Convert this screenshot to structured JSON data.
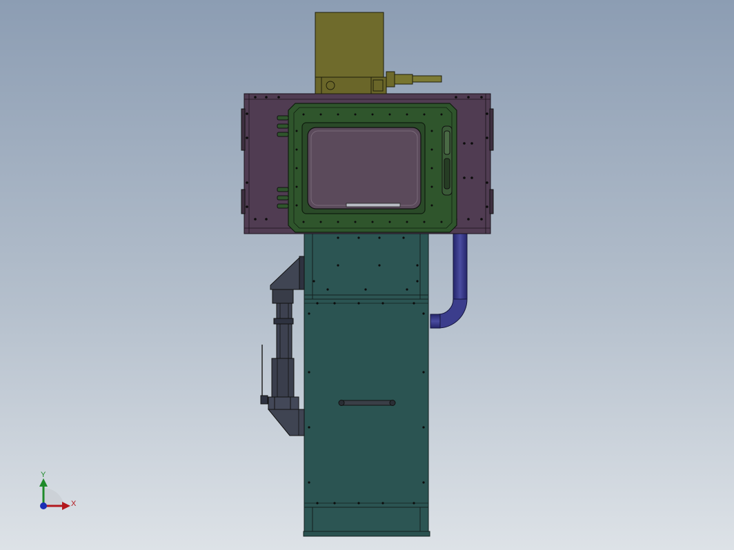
{
  "viewport": {
    "background": "gradient-grey-blue"
  },
  "model": {
    "parts": [
      {
        "name": "gear-motor",
        "color": "#6e6a2b"
      },
      {
        "name": "motor-shaft",
        "color": "#7d7b34"
      },
      {
        "name": "upper-housing",
        "color": "#503c52"
      },
      {
        "name": "door-frame",
        "color": "#2f552c"
      },
      {
        "name": "viewing-window",
        "color": "#5b4a5b"
      },
      {
        "name": "lower-column",
        "color": "#2b5452"
      },
      {
        "name": "side-arm-assembly",
        "color": "#3f4452"
      },
      {
        "name": "coolant-pipe",
        "color": "#34357a"
      },
      {
        "name": "column-handle",
        "color": "#3a3f47"
      }
    ]
  },
  "triad": {
    "x_label": "X",
    "y_label": "Y",
    "x_color": "#b3181d",
    "y_color": "#1f8a2a",
    "z_color": "#1b2fb5"
  }
}
